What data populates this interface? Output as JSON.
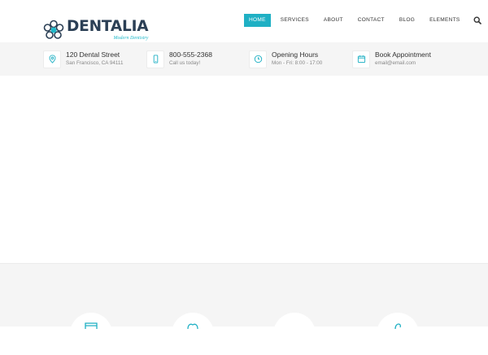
{
  "brand": {
    "name": "DENTALIA",
    "tagline": "Modern Dentistry",
    "color_primary": "#1fb0c4",
    "color_dark": "#2b3f55"
  },
  "nav": {
    "items": [
      {
        "label": "HOME",
        "active": true
      },
      {
        "label": "SERVICES",
        "active": false
      },
      {
        "label": "ABOUT",
        "active": false
      },
      {
        "label": "CONTACT",
        "active": false
      },
      {
        "label": "BLOG",
        "active": false
      },
      {
        "label": "ELEMENTS",
        "active": false
      }
    ],
    "search_icon": "search-icon"
  },
  "infobar": {
    "items": [
      {
        "icon": "location-pin-icon",
        "title": "120 Dental Street",
        "sub": "San Francisco, CA 94111"
      },
      {
        "icon": "mobile-phone-icon",
        "title": "800-555-2368",
        "sub": "Call us today!"
      },
      {
        "icon": "clock-icon",
        "title": "Opening Hours",
        "sub": "Mon - Fri: 8:00 - 17:00"
      },
      {
        "icon": "calendar-icon",
        "title": "Book Appointment",
        "sub": "email@email.com"
      }
    ]
  },
  "features": {
    "icons": [
      "calendar-icon",
      "tooth-icon",
      "chair-icon",
      "tooth-brush-icon"
    ]
  }
}
